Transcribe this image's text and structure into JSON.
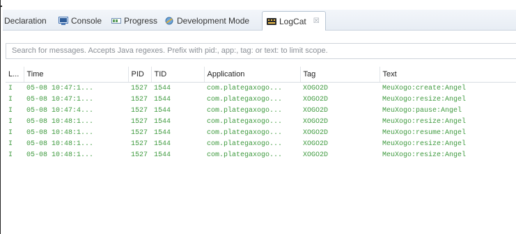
{
  "tabs": [
    {
      "label": "Declaration",
      "icon": "declaration-icon"
    },
    {
      "label": "Console",
      "icon": "console-icon"
    },
    {
      "label": "Progress",
      "icon": "progress-icon"
    },
    {
      "label": "Development Mode",
      "icon": "development-mode-icon"
    },
    {
      "label": "LogCat",
      "icon": "logcat-icon",
      "close": "☒",
      "active": true
    }
  ],
  "search": {
    "placeholder": "Search for messages. Accepts Java regexes. Prefix with pid:, app:, tag: or text: to limit scope."
  },
  "table": {
    "headers": [
      "L...",
      "Time",
      "PID",
      "TID",
      "Application",
      "Tag",
      "Text"
    ],
    "rows": [
      [
        "I",
        "05-08 10:47:1...",
        "1527",
        "1544",
        "com.plategaxogo...",
        "XOGO2D",
        "MeuXogo:create:Angel"
      ],
      [
        "I",
        "05-08 10:47:1...",
        "1527",
        "1544",
        "com.plategaxogo...",
        "XOGO2D",
        "MeuXogo:resize:Angel"
      ],
      [
        "I",
        "05-08 10:47:4...",
        "1527",
        "1544",
        "com.plategaxogo...",
        "XOGO2D",
        "MeuXogo:pause:Angel"
      ],
      [
        "I",
        "05-08 10:48:1...",
        "1527",
        "1544",
        "com.plategaxogo...",
        "XOGO2D",
        "MeuXogo:resize:Angel"
      ],
      [
        "I",
        "05-08 10:48:1...",
        "1527",
        "1544",
        "com.plategaxogo...",
        "XOGO2D",
        "MeuXogo:resume:Angel"
      ],
      [
        "I",
        "05-08 10:48:1...",
        "1527",
        "1544",
        "com.plategaxogo...",
        "XOGO2D",
        "MeuXogo:resize:Angel"
      ],
      [
        "I",
        "05-08 10:48:1...",
        "1527",
        "1544",
        "com.plategaxogo...",
        "XOGO2D",
        "MeuXogo:resize:Angel"
      ]
    ]
  },
  "colors": {
    "log_text": "#3f9a3f",
    "tab_bar": "#e9eef4"
  }
}
